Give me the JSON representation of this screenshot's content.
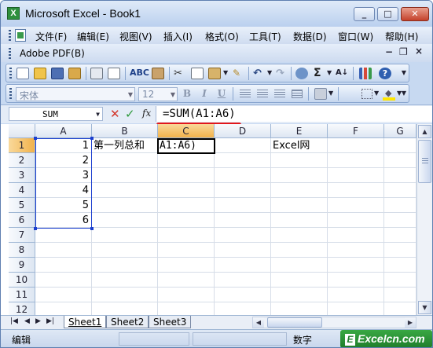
{
  "window": {
    "title": "Microsoft Excel - Book1",
    "app_icon": "excel-icon",
    "controls": {
      "minimize": "0",
      "maximize": "1",
      "close": "r"
    }
  },
  "menubar": {
    "items": [
      {
        "label": "文件(F)"
      },
      {
        "label": "编辑(E)"
      },
      {
        "label": "视图(V)"
      },
      {
        "label": "插入(I)"
      },
      {
        "label": "格式(O)"
      },
      {
        "label": "工具(T)"
      },
      {
        "label": "数据(D)"
      },
      {
        "label": "窗口(W)"
      },
      {
        "label": "帮助(H)"
      }
    ],
    "doc_min": "−",
    "doc_restore": "❐",
    "doc_close": "×"
  },
  "adobe_bar": {
    "label": "Adobe PDF(B)"
  },
  "standard_toolbar": {
    "icons": [
      "new-icon",
      "open-icon",
      "save-icon",
      "permission-icon",
      "print-icon",
      "print-preview-icon",
      "spelling-icon",
      "research-icon",
      "cut-icon",
      "copy-icon",
      "paste-icon",
      "format-painter-icon",
      "undo-icon",
      "redo-icon",
      "hyperlink-icon",
      "autosum-icon",
      "sort-ascending-icon",
      "chart-wizard-icon",
      "help-icon"
    ],
    "sum_glyph": "Σ",
    "sort_glyph": "A↓",
    "spell_glyph": "ABC",
    "help_glyph": "?"
  },
  "format_toolbar": {
    "font_name": "宋体",
    "font_size": "12",
    "bold": "B",
    "italic": "I",
    "underline": "U"
  },
  "formula_bar": {
    "name_box": "SUM",
    "cancel": "✕",
    "enter": "✓",
    "insert_function": "fx",
    "formula": "=SUM(A1:A6)"
  },
  "grid": {
    "columns": [
      "A",
      "B",
      "C",
      "D",
      "E",
      "F",
      "G"
    ],
    "active_column": "C",
    "rows": [
      "1",
      "2",
      "3",
      "4",
      "5",
      "6",
      "7",
      "8",
      "9",
      "10",
      "11",
      "12"
    ],
    "active_row": "1",
    "cells": {
      "A1": "1",
      "A2": "2",
      "A3": "3",
      "A4": "4",
      "A5": "5",
      "A6": "6",
      "B1": "第一列总和",
      "E1": "Excel网"
    },
    "editing_cell": {
      "ref": "C1",
      "text": "A1:A6)"
    },
    "reference_range": "A1:A6"
  },
  "sheets": {
    "tabs": [
      {
        "label": "Sheet1",
        "active": true
      },
      {
        "label": "Sheet2",
        "active": false
      },
      {
        "label": "Sheet3",
        "active": false
      }
    ]
  },
  "statusbar": {
    "mode": "编辑",
    "num_indicator": "数字"
  },
  "watermark": {
    "mark": "E",
    "text": "Excelcn.com",
    "color": "#1f7d2b"
  },
  "colors": {
    "title_bar": "#c7d9f1",
    "active_header": "#f1b24b",
    "range_border": "#1c3fcf",
    "underline_annotation": "#e2161b"
  }
}
